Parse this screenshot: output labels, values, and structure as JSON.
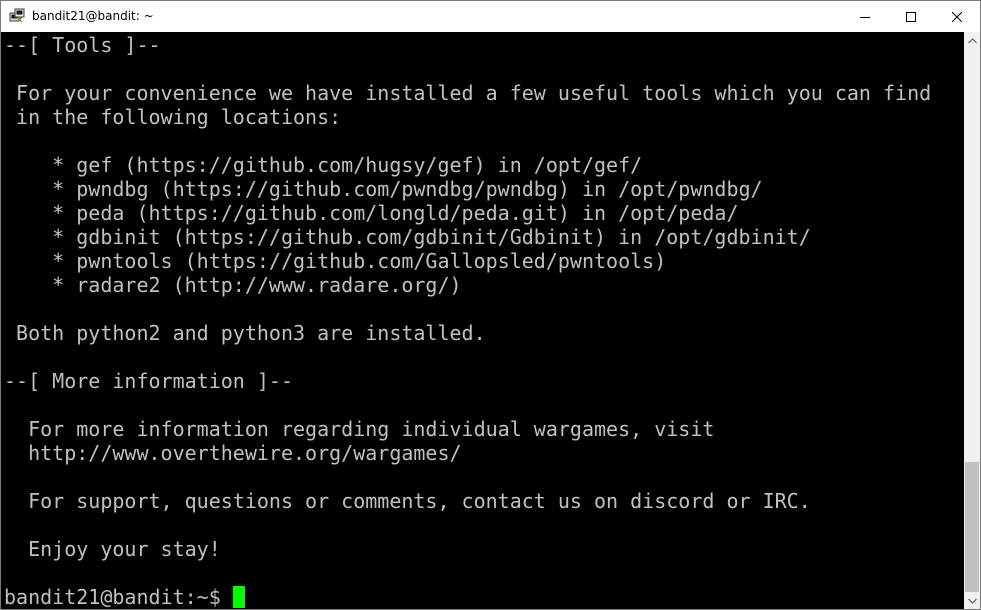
{
  "window": {
    "title": "bandit21@bandit: ~",
    "icon": "putty-icon",
    "controls": {
      "minimize_icon": "minimize-icon",
      "maximize_icon": "maximize-icon",
      "close_icon": "close-icon"
    }
  },
  "terminal": {
    "foreground": "#c0c0c0",
    "background": "#000000",
    "cursor_color": "#00ff00",
    "lines": [
      "--[ Tools ]--",
      "",
      " For your convenience we have installed a few useful tools which you can find",
      " in the following locations:",
      "",
      "    * gef (https://github.com/hugsy/gef) in /opt/gef/",
      "    * pwndbg (https://github.com/pwndbg/pwndbg) in /opt/pwndbg/",
      "    * peda (https://github.com/longld/peda.git) in /opt/peda/",
      "    * gdbinit (https://github.com/gdbinit/Gdbinit) in /opt/gdbinit/",
      "    * pwntools (https://github.com/Gallopsled/pwntools)",
      "    * radare2 (http://www.radare.org/)",
      "",
      " Both python2 and python3 are installed.",
      "",
      "--[ More information ]--",
      "",
      "  For more information regarding individual wargames, visit",
      "  http://www.overthewire.org/wargames/",
      "",
      "  For support, questions or comments, contact us on discord or IRC.",
      "",
      "  Enjoy your stay!",
      ""
    ],
    "prompt": "bandit21@bandit:~$ "
  }
}
